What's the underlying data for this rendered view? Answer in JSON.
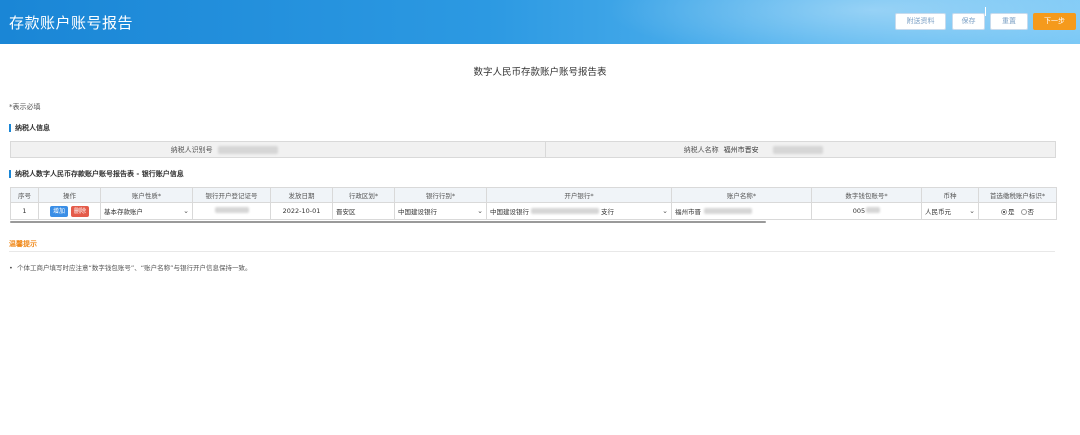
{
  "header": {
    "title": "存款账户账号报告",
    "buttons": {
      "attach": "附送资料",
      "save": "保存",
      "reset": "重置",
      "next": "下一步"
    }
  },
  "form": {
    "title": "数字人民币存款账户账号报告表",
    "required_note": "*表示必填"
  },
  "taxpayer": {
    "section_title": "纳税人信息",
    "id_label": "纳税人识别号",
    "id_value": "",
    "name_label": "纳税人名称",
    "name_value": "福州市晋安"
  },
  "bank": {
    "section_title": "纳税人数字人民币存款账户账号报告表 - 银行账户信息",
    "columns": [
      "序号",
      "操作",
      "账户性质*",
      "银行开户登记证号",
      "发放日期",
      "行政区划*",
      "银行行别*",
      "开户银行*",
      "账户名称*",
      "数字钱包账号*",
      "币种",
      "首选缴税账户标识*"
    ],
    "rows": [
      {
        "index": "1",
        "add": "增加",
        "delete": "删除",
        "account_type": "基本存款账户",
        "license_no": "",
        "issue_date": "2022-10-01",
        "district": "晋安区",
        "bank_type": "中国建设银行",
        "open_bank_prefix": "中国建设银行",
        "open_bank_suffix": "支行",
        "account_name": "福州市晋",
        "wallet_no": "005",
        "currency": "人民币元",
        "preferred_yes": "是",
        "preferred_no": "否"
      }
    ]
  },
  "tips": {
    "title": "温馨提示",
    "items": [
      "个体工商户填写时应注意“数字钱包账号”、“账户名称”与银行开户信息保持一致。"
    ]
  },
  "colors": {
    "header_blue": "#1a86d6",
    "accent_orange": "#f59a1c",
    "tips_orange": "#f08a1c",
    "delete_red": "#e45b4a",
    "add_blue": "#3a8ee6"
  }
}
